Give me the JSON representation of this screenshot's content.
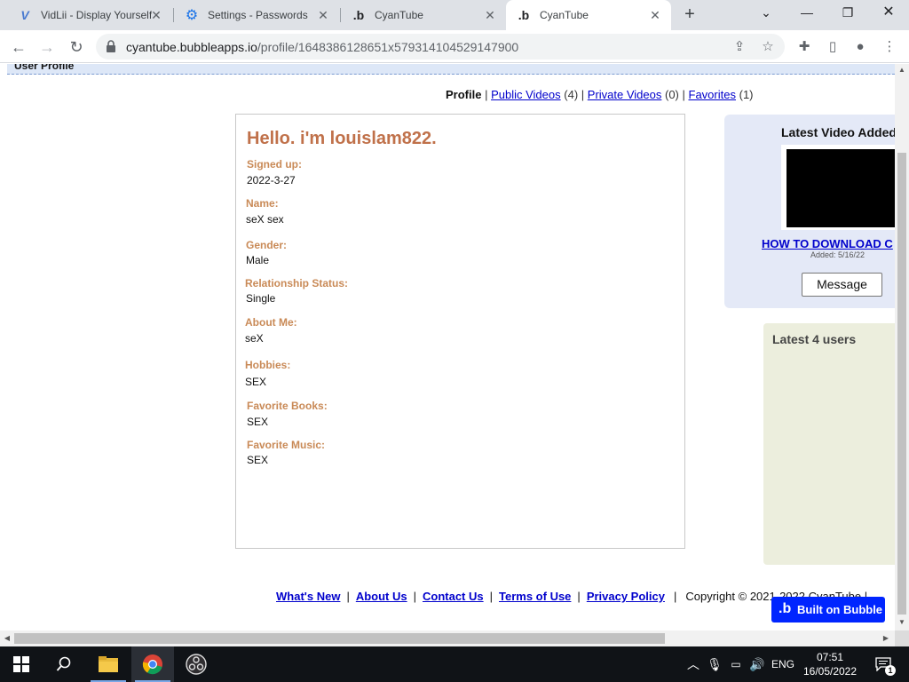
{
  "browser": {
    "tabs": [
      {
        "title": "VidLii - Display Yourself",
        "favicon": "vidlii-icon"
      },
      {
        "title": "Settings - Passwords",
        "favicon": "settings-gear-icon"
      },
      {
        "title": "CyanTube",
        "favicon": "bubble-icon"
      },
      {
        "title": "CyanTube",
        "favicon": "bubble-icon",
        "active": true
      }
    ],
    "url_host": "cyantube.bubbleapps.io",
    "url_path": "/profile/1648386128651x579314104529147900"
  },
  "page": {
    "header_title": "User Profile",
    "subnav": {
      "profile": "Profile",
      "public_videos": "Public Videos",
      "public_count": "(4)",
      "private_videos": "Private Videos",
      "private_count": "(0)",
      "favorites": "Favorites",
      "favorites_count": "(1)"
    },
    "profile": {
      "hello": "Hello. i'm louislam822.",
      "fields": [
        {
          "label": "Signed up:",
          "value": "2022-3-27"
        },
        {
          "label": "Name:",
          "value": "seX sex"
        },
        {
          "label": "Gender:",
          "value": "Male"
        },
        {
          "label": "Relationship Status:",
          "value": "Single"
        },
        {
          "label": "About Me:",
          "value": "seX"
        },
        {
          "label": "Hobbies:",
          "value": "SEX"
        },
        {
          "label": "Favorite Books:",
          "value": "SEX"
        },
        {
          "label": "Favorite Music:",
          "value": "SEX"
        }
      ]
    },
    "latest_video": {
      "title": "Latest Video Added",
      "video_title": "HOW TO DOWNLOAD C",
      "added": "Added: 5/16/22",
      "message_button": "Message"
    },
    "latest_users": {
      "title": "Latest 4 users"
    },
    "footer": {
      "links": [
        "What's New",
        "About Us",
        "Contact Us",
        "Terms of Use",
        "Privacy Policy"
      ],
      "copyright": "Copyright © 2021-2022 CyanTube |"
    },
    "bubble_badge": "Built on Bubble"
  },
  "taskbar": {
    "language": "ENG",
    "time": "07:51",
    "date": "16/05/2022",
    "notification_count": "1"
  }
}
